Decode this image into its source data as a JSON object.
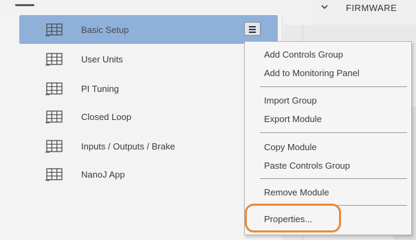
{
  "header": {
    "collapse_icon": "chevron-down-icon",
    "title_fragment": "FIRMWARE"
  },
  "tree": {
    "items": [
      {
        "label": "Basic Setup",
        "icon": "grid-icon",
        "selected": true
      },
      {
        "label": "User Units",
        "icon": "grid-icon",
        "selected": false
      },
      {
        "label": "PI Tuning",
        "icon": "grid-icon",
        "selected": false
      },
      {
        "label": "Closed Loop",
        "icon": "grid-icon",
        "selected": false
      },
      {
        "label": "Inputs / Outputs / Brake",
        "icon": "grid-icon",
        "selected": false
      },
      {
        "label": "NanoJ App",
        "icon": "grid-icon",
        "selected": false
      }
    ],
    "selected_menu_button_icon": "hamburger-menu-icon"
  },
  "context_menu": {
    "groups": [
      [
        "Add Controls Group",
        "Add to Monitoring Panel"
      ],
      [
        "Import Group",
        "Export Module"
      ],
      [
        "Copy Module",
        "Paste Controls Group"
      ],
      [
        "Remove Module"
      ],
      [
        "Properties..."
      ]
    ]
  },
  "highlight": {
    "target": "Properties...",
    "color": "#e98b36"
  },
  "colors": {
    "selection": "#8fb0d9",
    "panel_bg": "#f3f3f3",
    "menu_bg": "#f5f5f5"
  }
}
